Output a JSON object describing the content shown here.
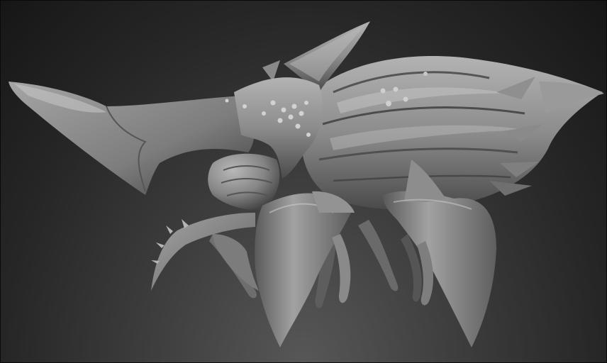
{
  "scene": {
    "subject": "sculpted-creature-render",
    "palette": {
      "background_top": "#161616",
      "background_bottom": "#575757",
      "clay_light": "#a9a9a9",
      "clay_mid": "#7a7a7a",
      "clay_dark": "#3a3a3a"
    }
  }
}
